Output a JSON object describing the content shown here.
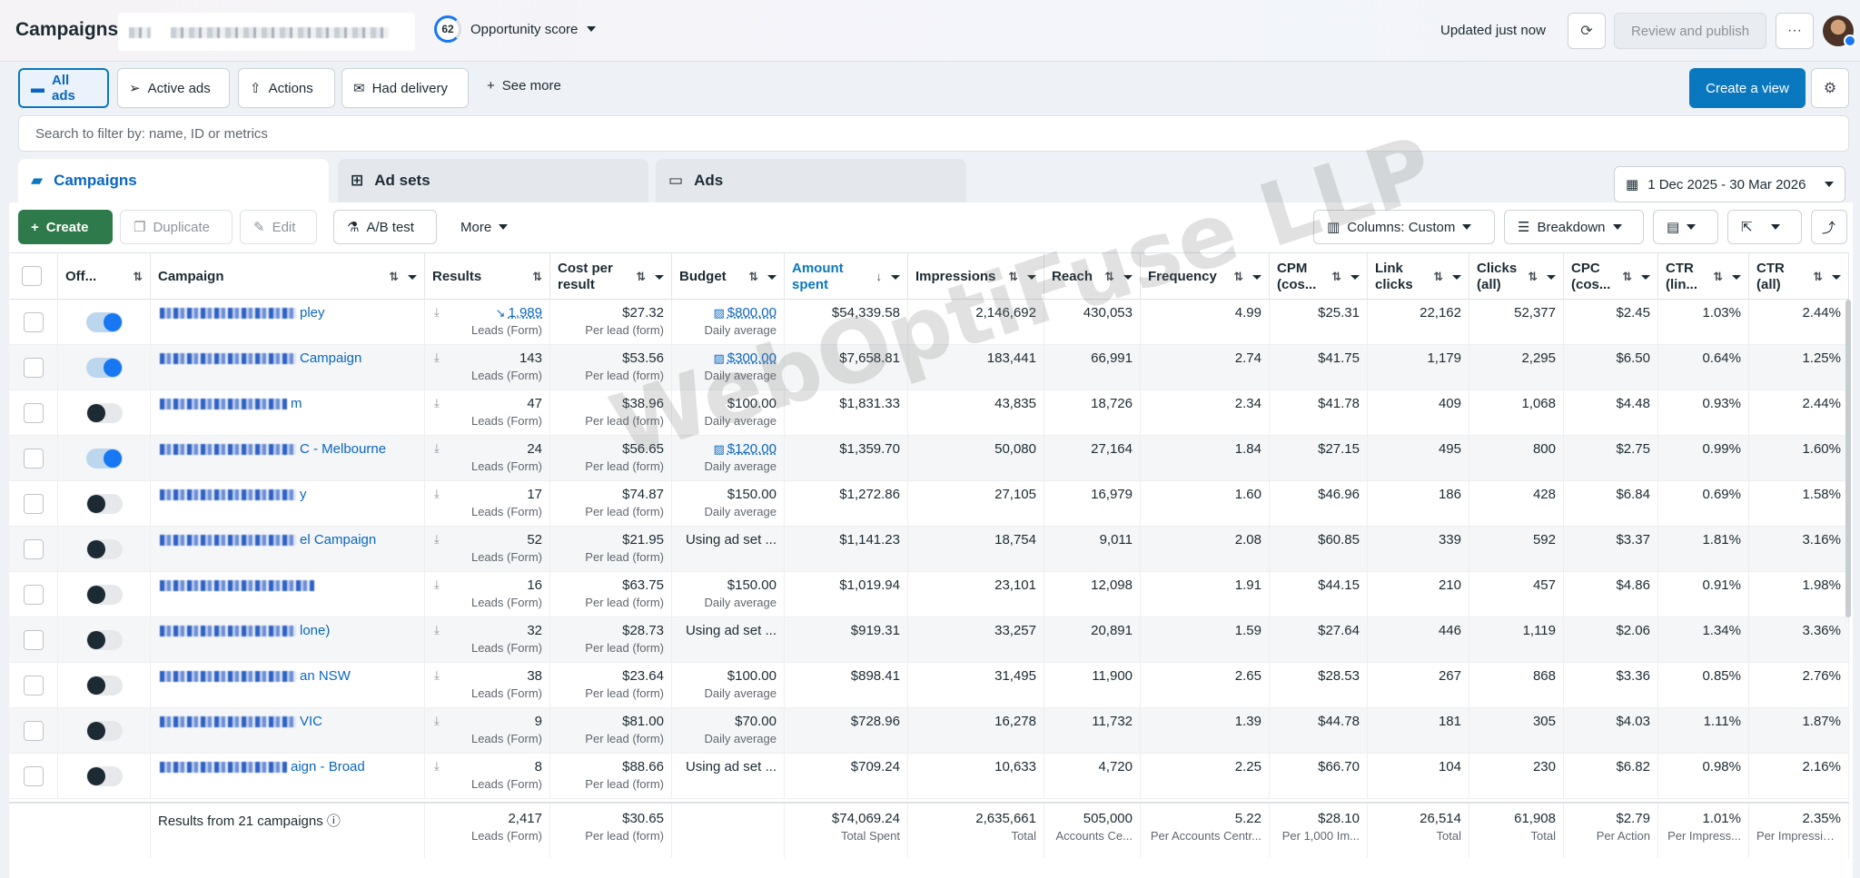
{
  "header": {
    "title": "Campaigns",
    "opportunity_score": "62",
    "opportunity_label": "Opportunity score",
    "updated": "Updated just now",
    "review_publish": "Review and publish",
    "more": "···"
  },
  "filters": {
    "all_ads": "All ads",
    "active_ads": "Active ads",
    "actions": "Actions",
    "had_delivery": "Had delivery",
    "see_more": "See more",
    "create_view": "Create a view"
  },
  "search": {
    "placeholder": "Search to filter by: name, ID or metrics"
  },
  "tabs": {
    "campaigns": "Campaigns",
    "ad_sets": "Ad sets",
    "ads": "Ads"
  },
  "date_range": "1 Dec 2025 - 30 Mar 2026",
  "toolbar": {
    "create": "Create",
    "duplicate": "Duplicate",
    "edit": "Edit",
    "ab_test": "A/B test",
    "more": "More",
    "columns": "Columns: Custom",
    "breakdown": "Breakdown"
  },
  "columns": {
    "off_on": "Off...",
    "campaign": "Campaign",
    "results": "Results",
    "cost_per_result": "Cost per result",
    "budget": "Budget",
    "amount_spent": "Amount spent",
    "impressions": "Impressions",
    "reach": "Reach",
    "frequency": "Frequency",
    "cpm": "CPM (cos...",
    "link_clicks": "Link clicks",
    "clicks_all": "Clicks (all)",
    "cpc": "CPC (cos...",
    "ctr_link": "CTR (lin...",
    "ctr_all": "CTR (all)"
  },
  "rows": [
    {
      "on": true,
      "name_visible": "pley",
      "results": "1,989",
      "results_link": true,
      "results_sub": "Leads (Form)",
      "cpr": "$27.32",
      "cpr_sub": "Per lead (form)",
      "budget": "$800.00",
      "budget_link": true,
      "budget_sub": "Daily average",
      "spent": "$54,339.58",
      "impressions": "2,146,692",
      "reach": "430,053",
      "frequency": "4.99",
      "cpm": "$25.31",
      "link_clicks": "22,162",
      "clicks": "52,377",
      "cpc": "$2.45",
      "ctr_link": "1.03%",
      "ctr_all": "2.44%"
    },
    {
      "on": true,
      "name_visible": "Campaign",
      "results": "143",
      "results_link": false,
      "results_sub": "Leads (Form)",
      "cpr": "$53.56",
      "cpr_sub": "Per lead (form)",
      "budget": "$300.00",
      "budget_link": true,
      "budget_sub": "Daily average",
      "spent": "$7,658.81",
      "impressions": "183,441",
      "reach": "66,991",
      "frequency": "2.74",
      "cpm": "$41.75",
      "link_clicks": "1,179",
      "clicks": "2,295",
      "cpc": "$6.50",
      "ctr_link": "0.64%",
      "ctr_all": "1.25%"
    },
    {
      "on": false,
      "name_visible": "m",
      "results": "47",
      "results_link": false,
      "results_sub": "Leads (Form)",
      "cpr": "$38.96",
      "cpr_sub": "Per lead (form)",
      "budget": "$100.00",
      "budget_link": false,
      "budget_sub": "Daily average",
      "spent": "$1,831.33",
      "impressions": "43,835",
      "reach": "18,726",
      "frequency": "2.34",
      "cpm": "$41.78",
      "link_clicks": "409",
      "clicks": "1,068",
      "cpc": "$4.48",
      "ctr_link": "0.93%",
      "ctr_all": "2.44%"
    },
    {
      "on": true,
      "name_visible": "C - Melbourne",
      "results": "24",
      "results_link": false,
      "results_sub": "Leads (Form)",
      "cpr": "$56.65",
      "cpr_sub": "Per lead (form)",
      "budget": "$120.00",
      "budget_link": true,
      "budget_sub": "Daily average",
      "spent": "$1,359.70",
      "impressions": "50,080",
      "reach": "27,164",
      "frequency": "1.84",
      "cpm": "$27.15",
      "link_clicks": "495",
      "clicks": "800",
      "cpc": "$2.75",
      "ctr_link": "0.99%",
      "ctr_all": "1.60%"
    },
    {
      "on": false,
      "name_visible": "y",
      "results": "17",
      "results_link": false,
      "results_sub": "Leads (Form)",
      "cpr": "$74.87",
      "cpr_sub": "Per lead (form)",
      "budget": "$150.00",
      "budget_link": false,
      "budget_sub": "Daily average",
      "spent": "$1,272.86",
      "impressions": "27,105",
      "reach": "16,979",
      "frequency": "1.60",
      "cpm": "$46.96",
      "link_clicks": "186",
      "clicks": "428",
      "cpc": "$6.84",
      "ctr_link": "0.69%",
      "ctr_all": "1.58%"
    },
    {
      "on": false,
      "name_visible": "el Campaign",
      "results": "52",
      "results_link": false,
      "results_sub": "Leads (Form)",
      "cpr": "$21.95",
      "cpr_sub": "Per lead (form)",
      "budget": "Using ad set ...",
      "budget_link": false,
      "budget_sub": "",
      "spent": "$1,141.23",
      "impressions": "18,754",
      "reach": "9,011",
      "frequency": "2.08",
      "cpm": "$60.85",
      "link_clicks": "339",
      "clicks": "592",
      "cpc": "$3.37",
      "ctr_link": "1.81%",
      "ctr_all": "3.16%"
    },
    {
      "on": false,
      "name_visible": "",
      "results": "16",
      "results_link": false,
      "results_sub": "Leads (Form)",
      "cpr": "$63.75",
      "cpr_sub": "Per lead (form)",
      "budget": "$150.00",
      "budget_link": false,
      "budget_sub": "Daily average",
      "spent": "$1,019.94",
      "impressions": "23,101",
      "reach": "12,098",
      "frequency": "1.91",
      "cpm": "$44.15",
      "link_clicks": "210",
      "clicks": "457",
      "cpc": "$4.86",
      "ctr_link": "0.91%",
      "ctr_all": "1.98%"
    },
    {
      "on": false,
      "name_visible": "lone)",
      "results": "32",
      "results_link": false,
      "results_sub": "Leads (Form)",
      "cpr": "$28.73",
      "cpr_sub": "Per lead (form)",
      "budget": "Using ad set ...",
      "budget_link": false,
      "budget_sub": "",
      "spent": "$919.31",
      "impressions": "33,257",
      "reach": "20,891",
      "frequency": "1.59",
      "cpm": "$27.64",
      "link_clicks": "446",
      "clicks": "1,119",
      "cpc": "$2.06",
      "ctr_link": "1.34%",
      "ctr_all": "3.36%"
    },
    {
      "on": false,
      "name_visible": "an NSW",
      "results": "38",
      "results_link": false,
      "results_sub": "Leads (Form)",
      "cpr": "$23.64",
      "cpr_sub": "Per lead (form)",
      "budget": "$100.00",
      "budget_link": false,
      "budget_sub": "Daily average",
      "spent": "$898.41",
      "impressions": "31,495",
      "reach": "11,900",
      "frequency": "2.65",
      "cpm": "$28.53",
      "link_clicks": "267",
      "clicks": "868",
      "cpc": "$3.36",
      "ctr_link": "0.85%",
      "ctr_all": "2.76%"
    },
    {
      "on": false,
      "name_visible": "VIC",
      "results": "9",
      "results_link": false,
      "results_sub": "Leads (Form)",
      "cpr": "$81.00",
      "cpr_sub": "Per lead (form)",
      "budget": "$70.00",
      "budget_link": false,
      "budget_sub": "Daily average",
      "spent": "$728.96",
      "impressions": "16,278",
      "reach": "11,732",
      "frequency": "1.39",
      "cpm": "$44.78",
      "link_clicks": "181",
      "clicks": "305",
      "cpc": "$4.03",
      "ctr_link": "1.11%",
      "ctr_all": "1.87%"
    },
    {
      "on": false,
      "name_visible": "aign - Broad",
      "results": "8",
      "results_link": false,
      "results_sub": "Leads (Form)",
      "cpr": "$88.66",
      "cpr_sub": "Per lead (form)",
      "budget": "Using ad set ...",
      "budget_link": false,
      "budget_sub": "",
      "spent": "$709.24",
      "impressions": "10,633",
      "reach": "4,720",
      "frequency": "2.25",
      "cpm": "$66.70",
      "link_clicks": "104",
      "clicks": "230",
      "cpc": "$6.82",
      "ctr_link": "0.98%",
      "ctr_all": "2.16%"
    }
  ],
  "totals": {
    "label": "Results from 21 campaigns",
    "results": "2,417",
    "results_sub": "Leads (Form)",
    "cpr": "$30.65",
    "cpr_sub": "Per lead (form)",
    "spent": "$74,069.24",
    "spent_sub": "Total Spent",
    "impressions": "2,635,661",
    "impressions_sub": "Total",
    "reach": "505,000",
    "reach_sub": "Accounts Ce...",
    "frequency": "5.22",
    "frequency_sub": "Per Accounts Centr...",
    "cpm": "$28.10",
    "cpm_sub": "Per 1,000 Im...",
    "link_clicks": "26,514",
    "link_clicks_sub": "Total",
    "clicks": "61,908",
    "clicks_sub": "Total",
    "cpc": "$2.79",
    "cpc_sub": "Per Action",
    "ctr_link": "1.01%",
    "ctr_link_sub": "Per Impress...",
    "ctr_all": "2.35%",
    "ctr_all_sub": "Per Impressions"
  },
  "watermark": "WebOptiFuse LLP",
  "colors": {
    "primary": "#0a78be",
    "create_green": "#2f7a4a",
    "link": "#0a66c2"
  }
}
